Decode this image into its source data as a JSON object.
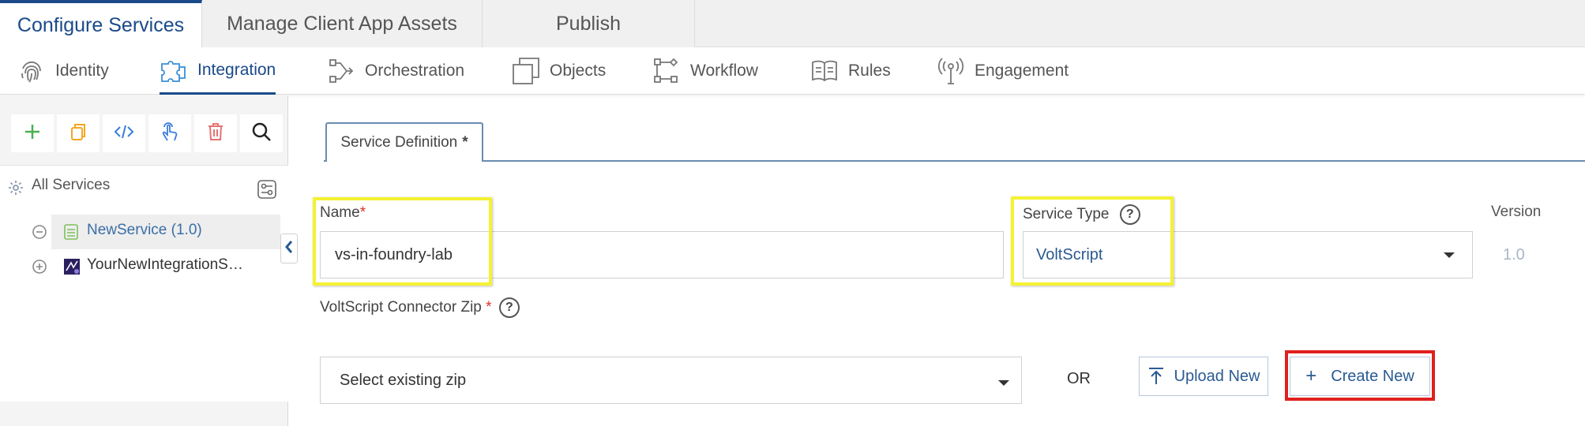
{
  "top_tabs": [
    {
      "label": "Configure Services"
    },
    {
      "label": "Manage Client App Assets"
    },
    {
      "label": "Publish"
    }
  ],
  "nav": {
    "items": [
      {
        "label": "Identity",
        "icon": "fingerprint-icon"
      },
      {
        "label": "Integration",
        "icon": "puzzle-icon"
      },
      {
        "label": "Orchestration",
        "icon": "flow-icon"
      },
      {
        "label": "Objects",
        "icon": "objects-icon"
      },
      {
        "label": "Workflow",
        "icon": "workflow-icon"
      },
      {
        "label": "Rules",
        "icon": "book-icon"
      },
      {
        "label": "Engagement",
        "icon": "broadcast-icon"
      }
    ],
    "active": "Integration"
  },
  "sidebar": {
    "all_services_label": "All Services",
    "services": [
      {
        "label": "NewService (1.0)",
        "selected": true
      },
      {
        "label": "YourNewIntegrationS…",
        "selected": false
      }
    ]
  },
  "form": {
    "tab_label": "Service Definition",
    "tab_marker": "*",
    "name_label": "Name",
    "required_marker": "*",
    "name_value": "vs-in-foundry-lab",
    "service_type_label": "Service Type",
    "service_type_value": "VoltScript",
    "version_label": "Version",
    "version_value": "1.0",
    "connector_zip_label": "VoltScript Connector Zip",
    "zip_select_value": "Select existing zip",
    "or_label": "OR",
    "upload_new_label": "Upload New",
    "create_new_label": "Create New",
    "help_glyph": "?"
  },
  "colors": {
    "accent": "#1a4a8a",
    "highlight_yellow": "#f4f232",
    "highlight_red": "#e0201e",
    "required": "#d9342b"
  }
}
